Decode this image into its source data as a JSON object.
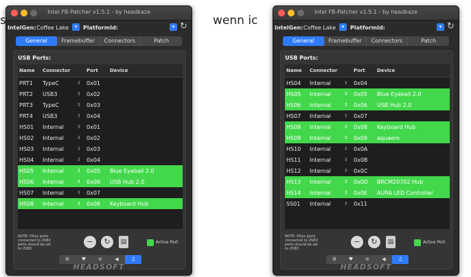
{
  "background": {
    "left_text": "s",
    "right_text": "wenn ic"
  },
  "app": {
    "title": "Intel FB-Patcher v1.5.1 - by headkaze",
    "inteldev_label": "IntelGen:",
    "inteldev_value": "Coffee Lake",
    "platform_label": "PlatformId:",
    "tabs": [
      "General",
      "Framebuffer",
      "Connectors",
      "Patch"
    ],
    "active_tab": "General",
    "usb_ports_label": "USB Ports:",
    "columns": [
      "Name",
      "Connector",
      "Port",
      "Device"
    ],
    "note": "NOTE: HSxx ports connected to USB3 ports should be set to USB3",
    "active_port_label": "Active Port",
    "toolbar_icons": [
      "gear-icon",
      "heart-icon",
      "list-icon",
      "speaker-icon",
      "music-icon"
    ],
    "brand": "HEADSOFT",
    "active_color": "#43d84c",
    "accent_color": "#2f7bf6"
  },
  "window_left": {
    "rows": [
      {
        "name": "PRT1",
        "connector": "TypeC",
        "port": "0x01",
        "device": "",
        "active": false
      },
      {
        "name": "PRT2",
        "connector": "USB3",
        "port": "0x02",
        "device": "",
        "active": false
      },
      {
        "name": "PRT3",
        "connector": "TypeC",
        "port": "0x03",
        "device": "",
        "active": false
      },
      {
        "name": "PRT4",
        "connector": "USB3",
        "port": "0x04",
        "device": "",
        "active": false
      },
      {
        "name": "HS01",
        "connector": "Internal",
        "port": "0x01",
        "device": "",
        "active": false
      },
      {
        "name": "HS02",
        "connector": "Internal",
        "port": "0x02",
        "device": "",
        "active": false
      },
      {
        "name": "HS03",
        "connector": "Internal",
        "port": "0x03",
        "device": "",
        "active": false
      },
      {
        "name": "HS04",
        "connector": "Internal",
        "port": "0x04",
        "device": "",
        "active": false
      },
      {
        "name": "HS05",
        "connector": "Internal",
        "port": "0x05",
        "device": "Blue Eyeball 2.0",
        "active": true
      },
      {
        "name": "HS06",
        "connector": "Internal",
        "port": "0x06",
        "device": "USB Hub 2.0",
        "active": true
      },
      {
        "name": "HS07",
        "connector": "Internal",
        "port": "0x07",
        "device": "",
        "active": false
      },
      {
        "name": "HS08",
        "connector": "Internal",
        "port": "0x08",
        "device": "Keyboard Hub",
        "active": true
      }
    ]
  },
  "window_right": {
    "rows": [
      {
        "name": "HS04",
        "connector": "Internal",
        "port": "0x04",
        "device": "",
        "active": false
      },
      {
        "name": "HS05",
        "connector": "Internal",
        "port": "0x05",
        "device": "Blue Eyeball 2.0",
        "active": true
      },
      {
        "name": "HS06",
        "connector": "Internal",
        "port": "0x06",
        "device": "USB Hub 2.0",
        "active": true
      },
      {
        "name": "HS07",
        "connector": "Internal",
        "port": "0x07",
        "device": "",
        "active": false
      },
      {
        "name": "HS08",
        "connector": "Internal",
        "port": "0x08",
        "device": "Keyboard Hub",
        "active": true
      },
      {
        "name": "HS09",
        "connector": "Internal",
        "port": "0x09",
        "device": "aquaero",
        "active": true
      },
      {
        "name": "HS10",
        "connector": "Internal",
        "port": "0x0A",
        "device": "",
        "active": false
      },
      {
        "name": "HS11",
        "connector": "Internal",
        "port": "0x0B",
        "device": "",
        "active": false
      },
      {
        "name": "HS12",
        "connector": "Internal",
        "port": "0x0C",
        "device": "",
        "active": false
      },
      {
        "name": "HS13",
        "connector": "Internal",
        "port": "0x0D",
        "device": "BRCM20702 Hub",
        "active": true
      },
      {
        "name": "HS14",
        "connector": "Internal",
        "port": "0x0E",
        "device": "AURA LED Controller",
        "active": true
      },
      {
        "name": "SS01",
        "connector": "Internal",
        "port": "0x11",
        "device": "",
        "active": false
      }
    ]
  }
}
